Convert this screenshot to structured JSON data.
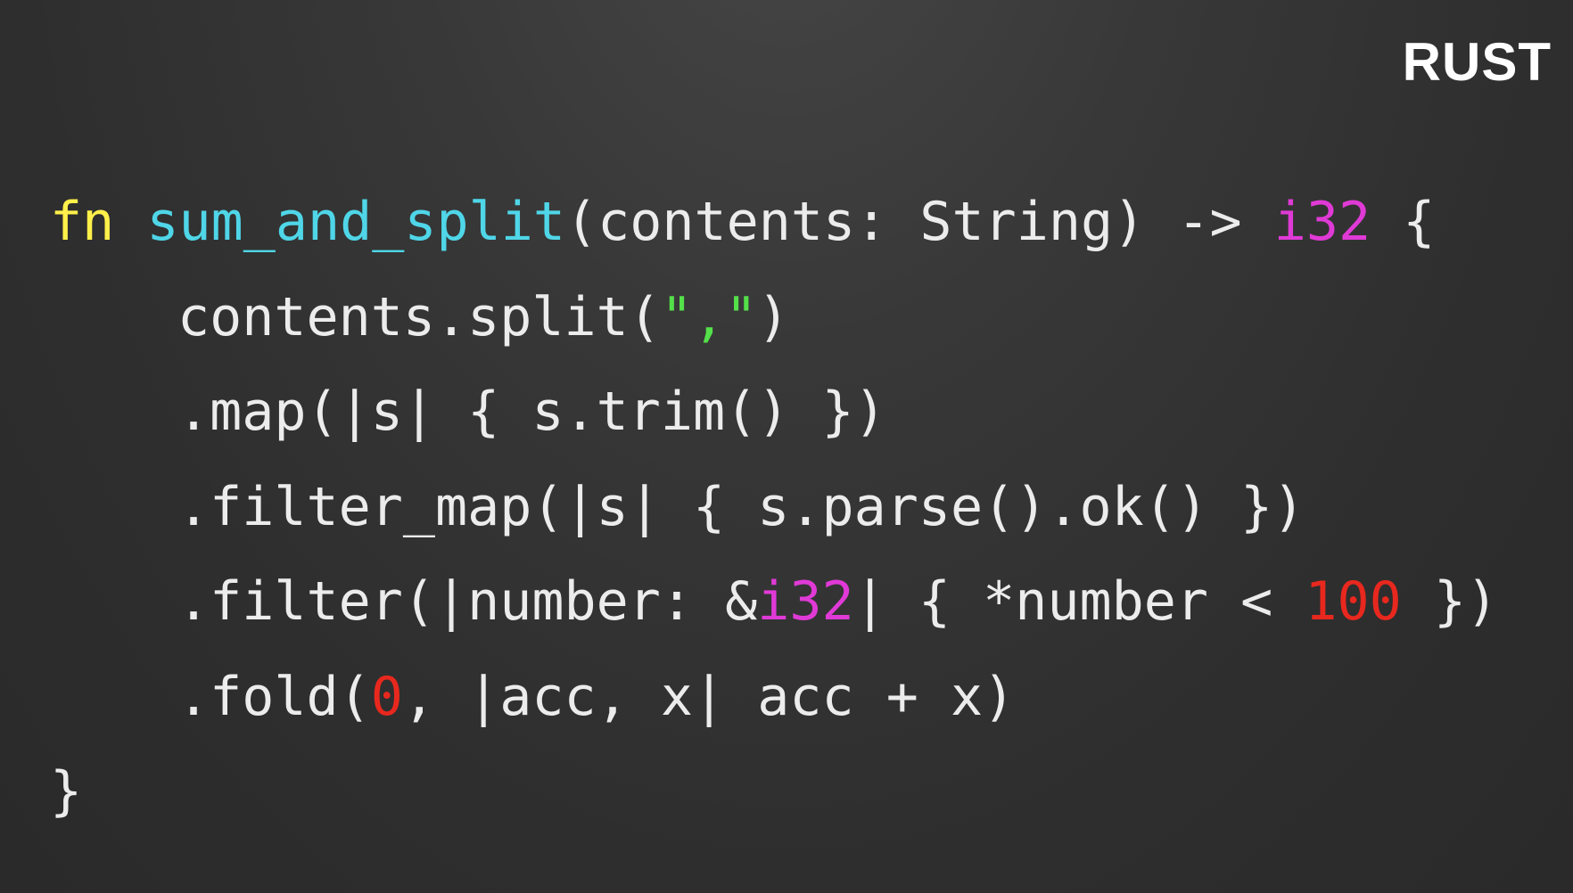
{
  "language_label": "RUST",
  "code": {
    "lines": [
      {
        "indent": false,
        "tokens": [
          {
            "text": "fn",
            "kind": "keyword"
          },
          {
            "text": " ",
            "kind": "plain"
          },
          {
            "text": "sum_and_split",
            "kind": "fn"
          },
          {
            "text": "(contents: String) -> ",
            "kind": "plain"
          },
          {
            "text": "i32",
            "kind": "type"
          },
          {
            "text": " {",
            "kind": "plain"
          }
        ]
      },
      {
        "indent": true,
        "tokens": [
          {
            "text": "contents.split(",
            "kind": "plain"
          },
          {
            "text": "\",\"",
            "kind": "string"
          },
          {
            "text": ")",
            "kind": "plain"
          }
        ]
      },
      {
        "indent": true,
        "tokens": [
          {
            "text": ".map(|s| { s.trim() })",
            "kind": "plain"
          }
        ]
      },
      {
        "indent": true,
        "tokens": [
          {
            "text": ".filter_map(|s| { s.parse().ok() })",
            "kind": "plain"
          }
        ]
      },
      {
        "indent": true,
        "tokens": [
          {
            "text": ".filter(|number: &",
            "kind": "plain"
          },
          {
            "text": "i32",
            "kind": "type"
          },
          {
            "text": "| { *number < ",
            "kind": "plain"
          },
          {
            "text": "100",
            "kind": "number"
          },
          {
            "text": " })",
            "kind": "plain"
          }
        ]
      },
      {
        "indent": true,
        "tokens": [
          {
            "text": ".fold(",
            "kind": "plain"
          },
          {
            "text": "0",
            "kind": "number"
          },
          {
            "text": ", |acc, x| acc + x)",
            "kind": "plain"
          }
        ]
      },
      {
        "indent": false,
        "tokens": [
          {
            "text": "}",
            "kind": "plain"
          }
        ]
      }
    ]
  },
  "colors": {
    "background": "#333333",
    "keyword": "#fff04a",
    "function": "#4fd6e8",
    "type": "#e03ad6",
    "string": "#54e04a",
    "number": "#e8281e",
    "text": "#ececec"
  }
}
